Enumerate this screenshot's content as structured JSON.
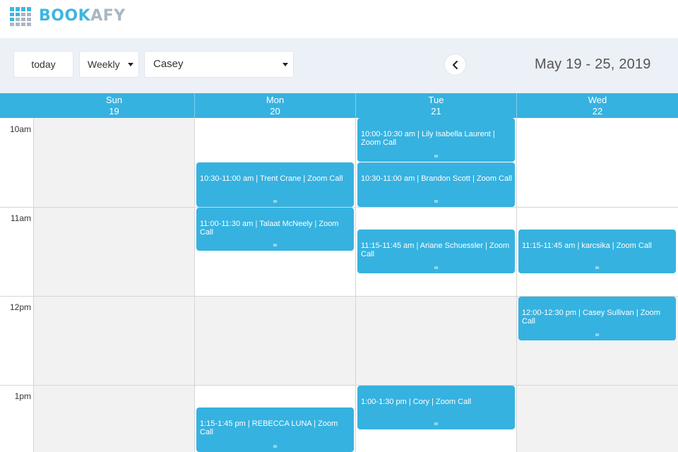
{
  "brand": {
    "name_part1": "BOOK",
    "name_part2": "AFY",
    "icon": "calendar-grid-logo-icon"
  },
  "toolbar": {
    "today_label": "today",
    "view_value": "Weekly",
    "user_value": "Casey",
    "prev_icon": "chevron-left-icon",
    "date_range": "May 19 - 25, 2019"
  },
  "calendar": {
    "days": [
      {
        "name": "Sun",
        "date": "19"
      },
      {
        "name": "Mon",
        "date": "20"
      },
      {
        "name": "Tue",
        "date": "21"
      },
      {
        "name": "Wed",
        "date": "22"
      }
    ],
    "hours": [
      "10am",
      "11am",
      "12pm",
      "1pm"
    ],
    "events": [
      {
        "text": "10:00-10:30 am | Lily Isabella Laurent | Zoom Call",
        "grip": "="
      },
      {
        "text": "10:30-11:00 am | Trent Crane | Zoom Call",
        "grip": "="
      },
      {
        "text": "10:30-11:00 am | Brandon Scott | Zoom Call",
        "grip": "="
      },
      {
        "text": "11:00-11:30 am | Talaat McNeely | Zoom Call",
        "grip": "="
      },
      {
        "text": "11:15-11:45 am | Ariane Schuessler | Zoom Call",
        "grip": "="
      },
      {
        "text": "11:15-11:45 am | karcsika | Zoom Call",
        "grip": "="
      },
      {
        "text": "12:00-12:30 pm | Casey Sullivan | Zoom Call",
        "grip": "="
      },
      {
        "text": "1:00-1:30 pm | Cory | Zoom Call",
        "grip": "="
      },
      {
        "text": "1:15-1:45 pm | REBECCA LUNA | Zoom Call",
        "grip": "="
      }
    ]
  },
  "colors": {
    "accent": "#36b2e0",
    "toolbar_bg": "#ecf0f7",
    "logo_blue": "#3fb6e0",
    "logo_gray": "#a9b7c2"
  }
}
